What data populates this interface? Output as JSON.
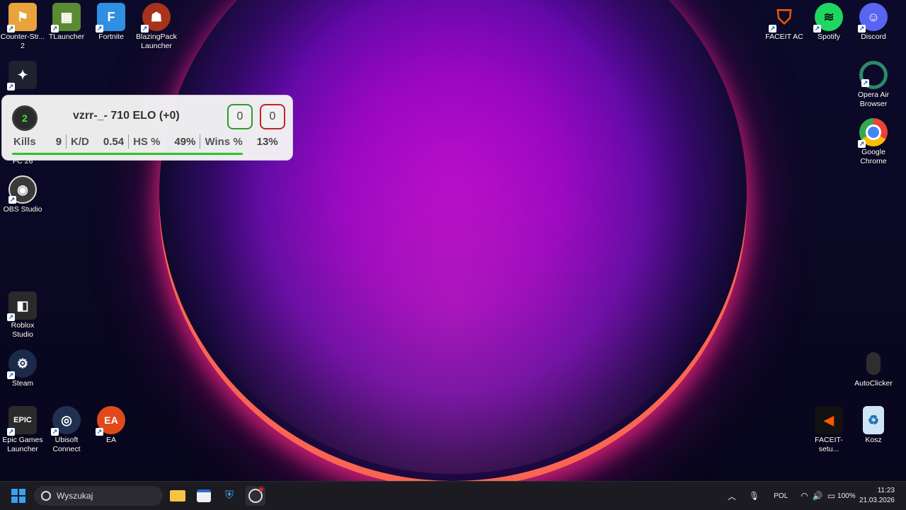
{
  "desktop": {
    "left_icons": [
      {
        "label": "Counter-Str... 2",
        "icon": "cs2-icon",
        "color": "#e8a33a"
      },
      {
        "label": "TLauncher",
        "icon": "minecraft-icon",
        "color": "#5a8a32"
      },
      {
        "label": "Fortnite",
        "icon": "fortnite-icon",
        "color": "#2f8fe0"
      },
      {
        "label": "BlazingPack Launcher",
        "icon": "blazingpack-icon",
        "color": "#a8321c"
      },
      {
        "label": "OBS Studio",
        "icon": "obs-icon",
        "color": "#3a3a3a"
      },
      {
        "label": "Roblox Studio",
        "icon": "roblox-icon",
        "color": "#2a2a2a"
      },
      {
        "label": "Steam",
        "icon": "steam-icon",
        "color": "#1b2a4a"
      },
      {
        "label": "Epic Games Launcher",
        "icon": "epic-icon",
        "color": "#2a2a2a"
      },
      {
        "label": "Ubisoft Connect",
        "icon": "ubisoft-icon",
        "color": "#203050"
      },
      {
        "label": "EA",
        "icon": "ea-icon",
        "color": "#e04a1a"
      }
    ],
    "partial_labels": [
      "FC 26"
    ],
    "right_icons": [
      {
        "label": "FACEIT AC",
        "icon": "faceit-ac-icon",
        "color": "#ff5500"
      },
      {
        "label": "Spotify",
        "icon": "spotify-icon",
        "color": "#1ed760"
      },
      {
        "label": "Discord",
        "icon": "discord-icon",
        "color": "#5865f2"
      },
      {
        "label": "Opera Air Browser",
        "icon": "opera-icon",
        "color": "#2a8a6a"
      },
      {
        "label": "Google Chrome",
        "icon": "chrome-icon",
        "color": "#4285f4"
      },
      {
        "label": "AutoClicker",
        "icon": "mouse-icon",
        "color": "#3a3a3a"
      },
      {
        "label": "FACEIT-setu...",
        "icon": "faceit-setup-icon",
        "color": "#ff5500"
      },
      {
        "label": "Kosz",
        "icon": "recycle-bin-icon",
        "color": "#cfe4f5"
      }
    ]
  },
  "overlay": {
    "level": "2",
    "title": "vzrr-_- 710 ELO (+0)",
    "wins": "0",
    "losses": "0",
    "stats": {
      "kills_label": "Kills",
      "kills": "9",
      "kd_label": "K/D",
      "kd": "0.54",
      "hs_label": "HS %",
      "hs": "49%",
      "wins_label": "Wins %",
      "wins": "13%"
    }
  },
  "taskbar": {
    "search_placeholder": "Wyszukaj",
    "language": "POL",
    "battery": "100%",
    "time": "11:23",
    "date": "21.03.2026"
  }
}
